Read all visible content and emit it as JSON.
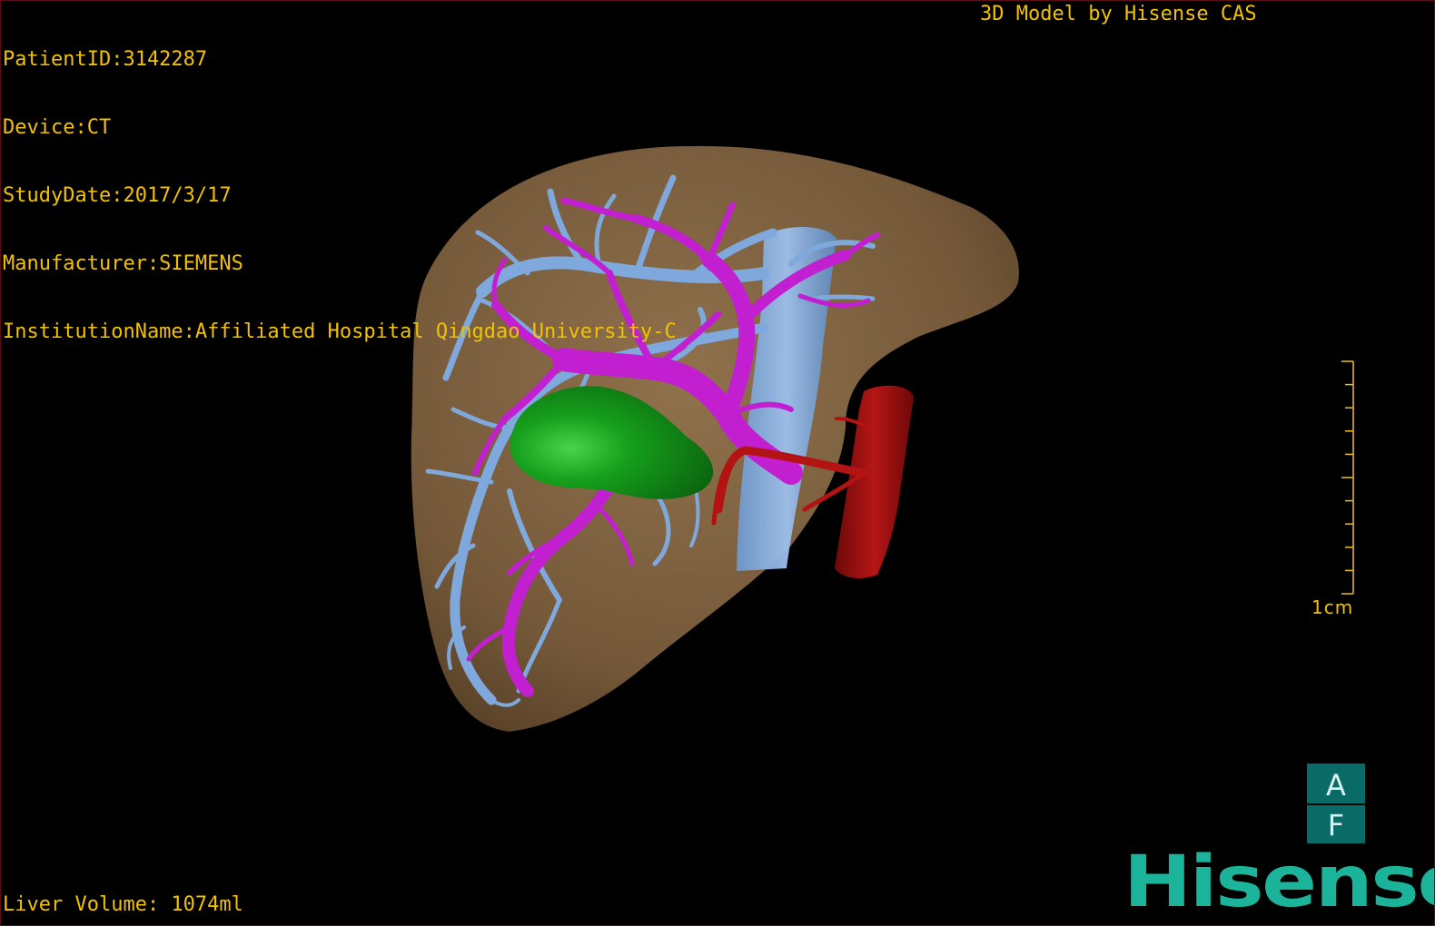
{
  "header": {
    "patient_id": "PatientID:3142287",
    "device": "Device:CT",
    "study_date": "StudyDate:2017/3/17",
    "manufacturer": "Manufacturer:SIEMENS",
    "institution": "InstitutionName:Affiliated Hospital Qingdao University-C",
    "credit": "3D Model by Hisense CAS"
  },
  "footer": {
    "liver_volume": "Liver Volume: 1074ml"
  },
  "scale": {
    "label": "1cm"
  },
  "orientation": {
    "top": "A",
    "bottom": "F"
  },
  "brand": {
    "logo_text": "Hisense"
  },
  "colors": {
    "overlay_text": "#f2c200",
    "liver": "#8a6a45",
    "hepatic_vein": "#7fa8dc",
    "portal_vein": "#c21fd0",
    "tumor": "#138a1a",
    "artery": "#b31313",
    "brand": "#1bb39a"
  }
}
